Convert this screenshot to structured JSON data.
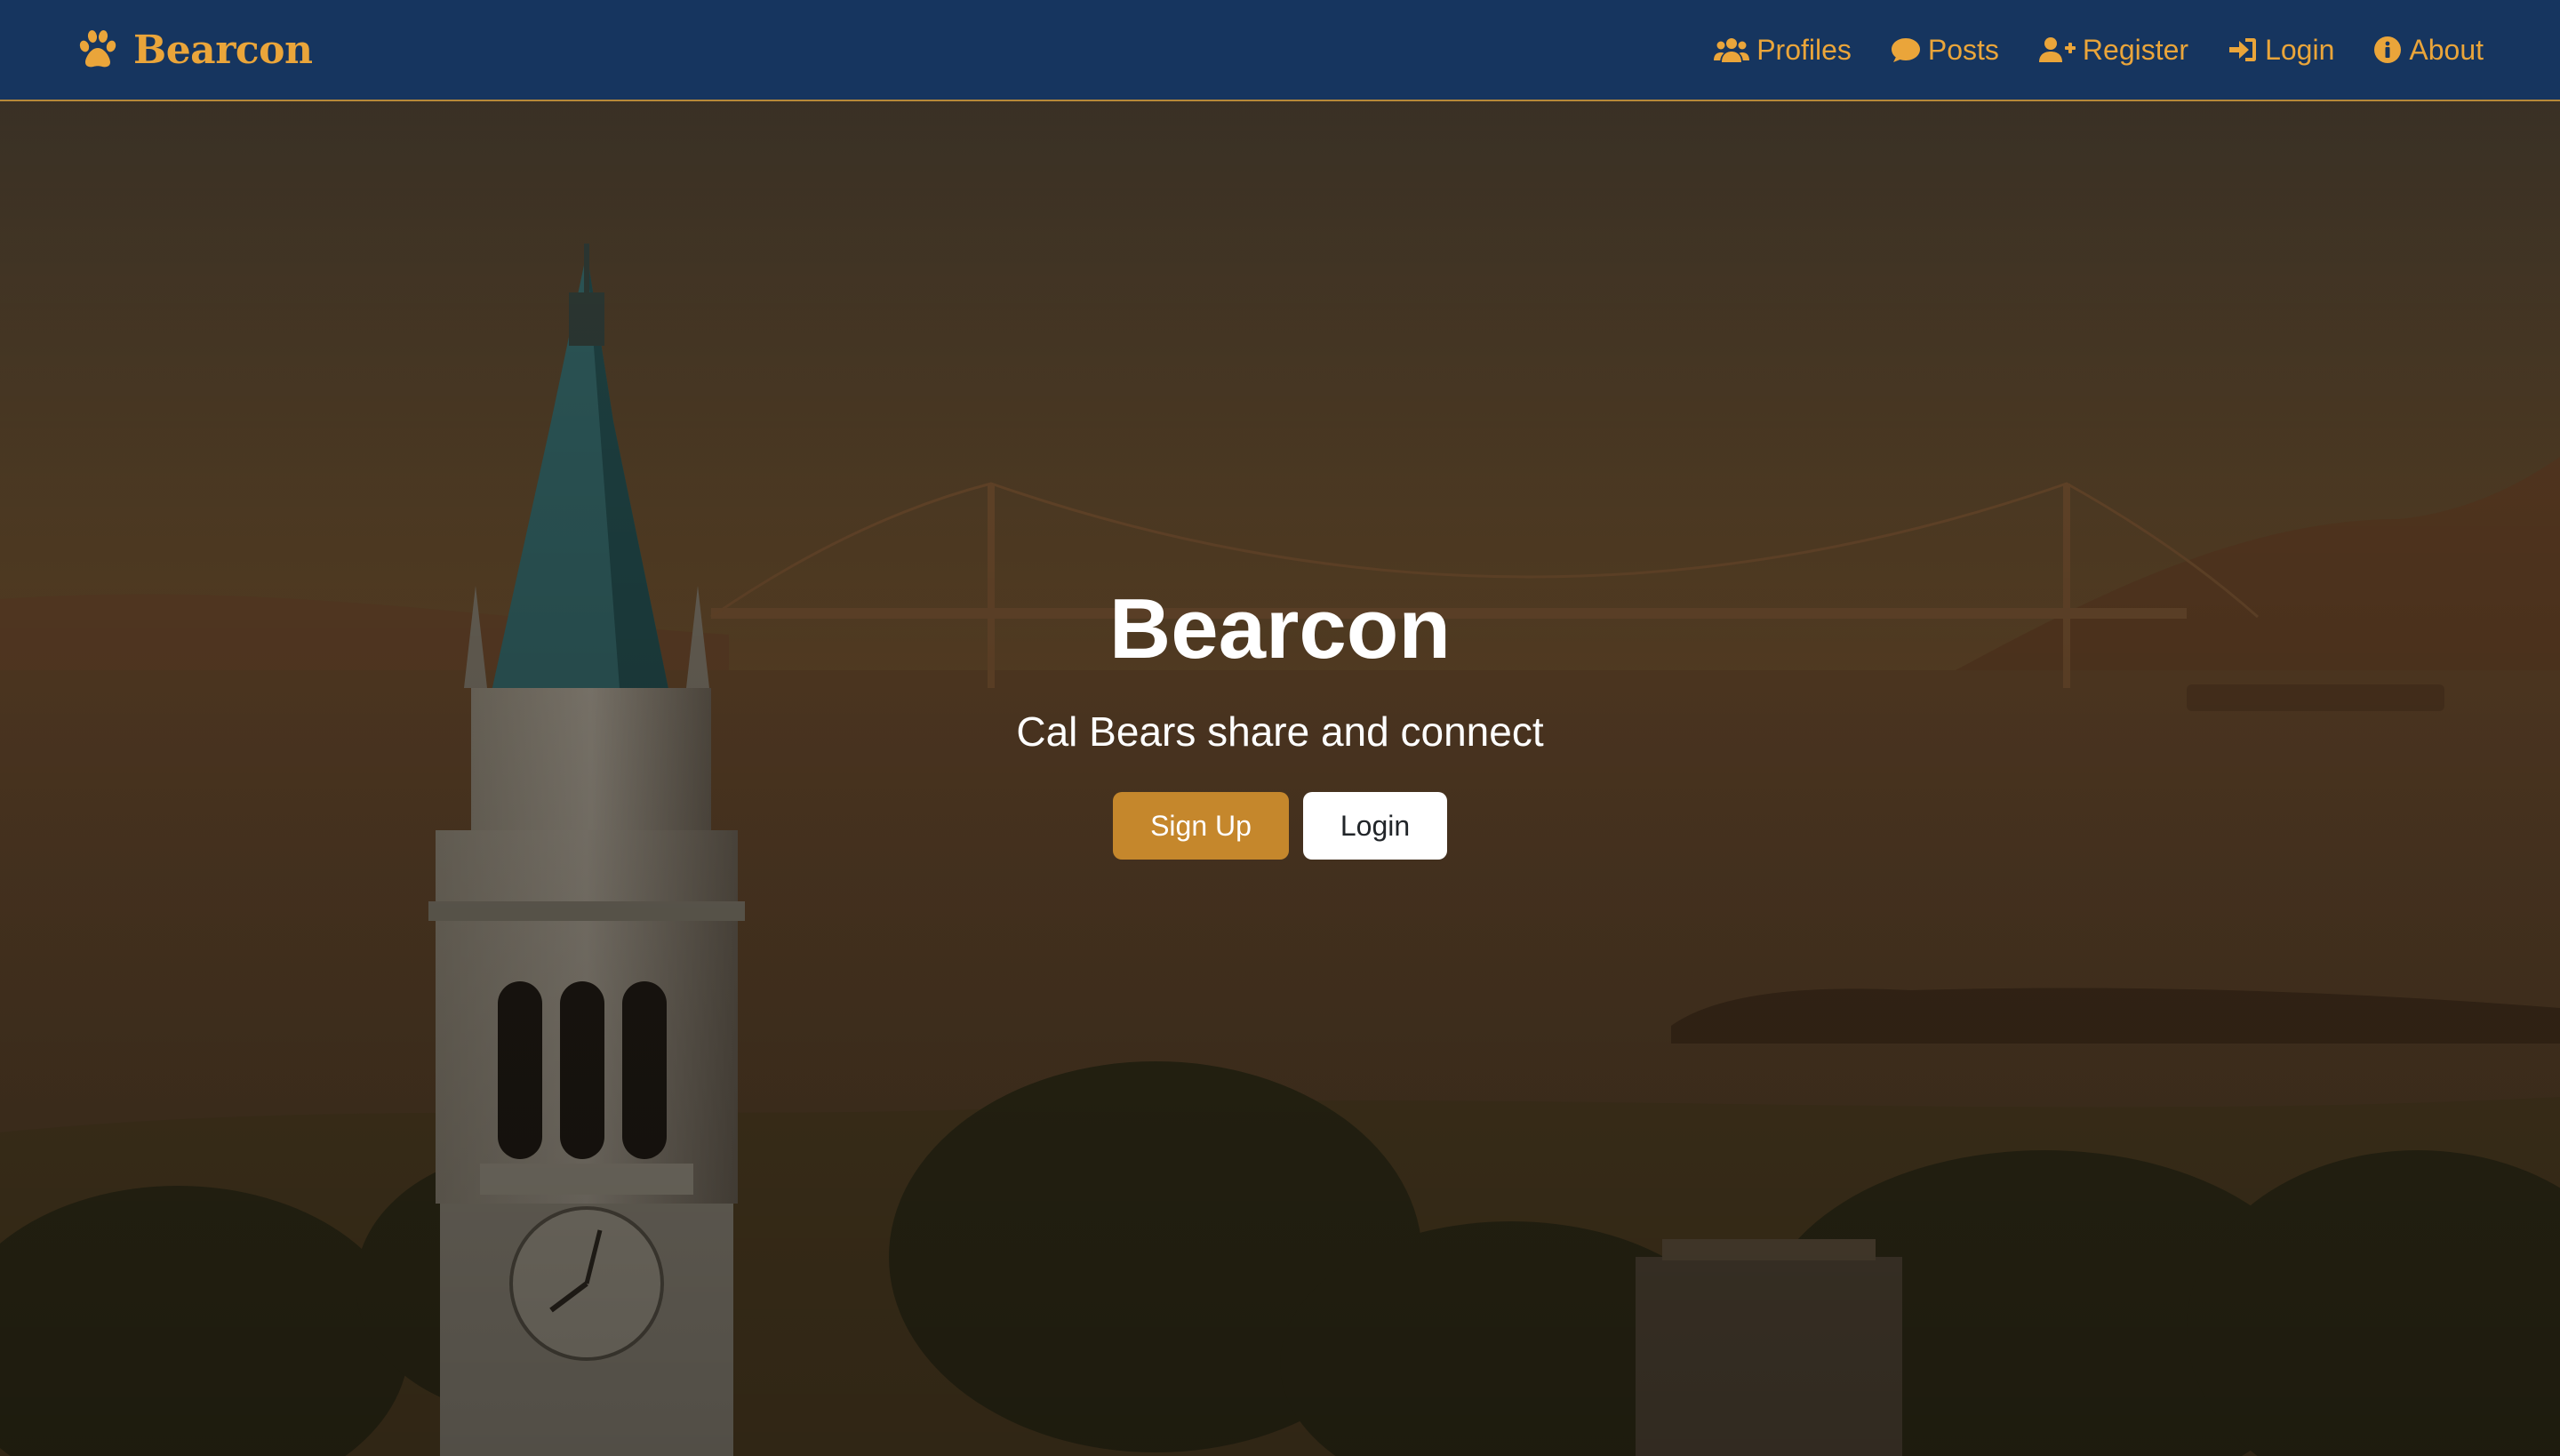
{
  "navbar": {
    "brand": "Bearcon",
    "brand_icon": "paw-icon",
    "links": [
      {
        "label": "Profiles",
        "icon": "users-icon"
      },
      {
        "label": "Posts",
        "icon": "comment-icon"
      },
      {
        "label": "Register",
        "icon": "user-plus-icon"
      },
      {
        "label": "Login",
        "icon": "sign-in-icon"
      },
      {
        "label": "About",
        "icon": "info-circle-icon"
      }
    ]
  },
  "hero": {
    "title": "Bearcon",
    "subtitle": "Cal Bears share and connect",
    "signup_label": "Sign Up",
    "login_label": "Login",
    "background": "sunset-campus-bay-bridge-image"
  },
  "colors": {
    "navbar_bg": "#16355f",
    "accent_gold": "#eaa53a",
    "button_primary": "#c5872c",
    "button_light": "#ffffff",
    "hero_text": "#ffffff"
  }
}
